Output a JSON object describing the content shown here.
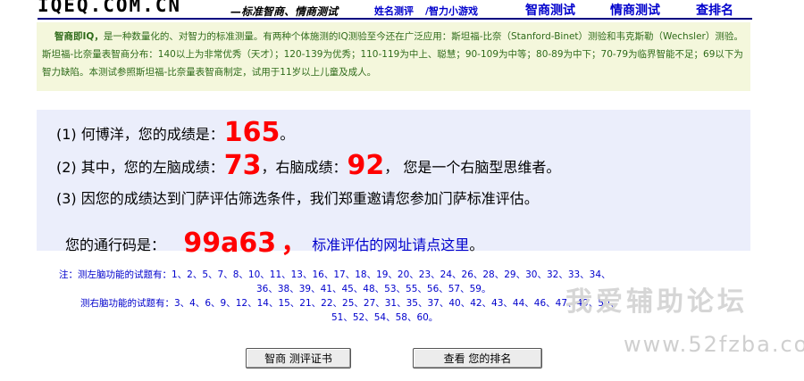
{
  "header": {
    "logo": "IQEQ.COM.CN",
    "tagline": "—标准智商、情商测试",
    "nav": [
      "姓名测评",
      "/智力小游戏",
      "智商测试",
      "情商测试",
      "查排名"
    ]
  },
  "intro": {
    "lead": "智商即IQ，",
    "text": "是一种数量化的、对智力的标准测量。有两种个体施测的IQ测验至今还在广泛应用：斯坦福-比奈（Stanford-Binet）测验和韦克斯勒（Wechsler）测验。 斯坦福-比奈量表智商分布：140以上为非常优秀（天才）；120-139为优秀；110-119为中上、聪慧；90-109为中等；80-89为中下；70-79为临界智能不足；69以下为智力缺陷。本测试参照斯坦福-比奈量表智商制定，试用于11岁以上儿童及成人。"
  },
  "result": {
    "line1_prefix": "(1) 何博洋，您的成绩是：",
    "score": "165",
    "line1_suffix": "。",
    "line2_prefix": "(2) 其中，您的左脑成绩：",
    "left_score": "73",
    "line2_mid": "，右脑成绩：",
    "right_score": "92",
    "line2_suffix": "，  您是一个右脑型思维者。",
    "line3": "(3) 因您的成绩达到门萨评估筛选条件，我们郑重邀请您参加门萨标准评估。",
    "pass_label": "您的通行码是：",
    "pass_code": "99a63",
    "pass_sep": "，",
    "pass_link": "标准评估的网址请点这里",
    "pass_end": "。"
  },
  "notes": {
    "left_label": "注：测左脑功能的试题有：",
    "left_items_1": "1、2、5、7、8、10、11、13、16、17、18、19、20、23、24、26、28、29、30、32、33、34、",
    "left_items_2": "36、38、39、41、45、48、53、55、56、57、59。",
    "right_label": "测右脑功能的试题有：",
    "right_items_1": "3、4、6、9、12、14、15、21、22、25、27、31、35、37、40、42、43、44、46、47、49、50、",
    "right_items_2": "51、52、54、58、60。"
  },
  "watermark": {
    "text": "我爱辅助论坛",
    "url": "www.52fzba.com"
  },
  "buttons": {
    "certificate": "智商 测评证书",
    "ranking": "查看 您的排名"
  }
}
